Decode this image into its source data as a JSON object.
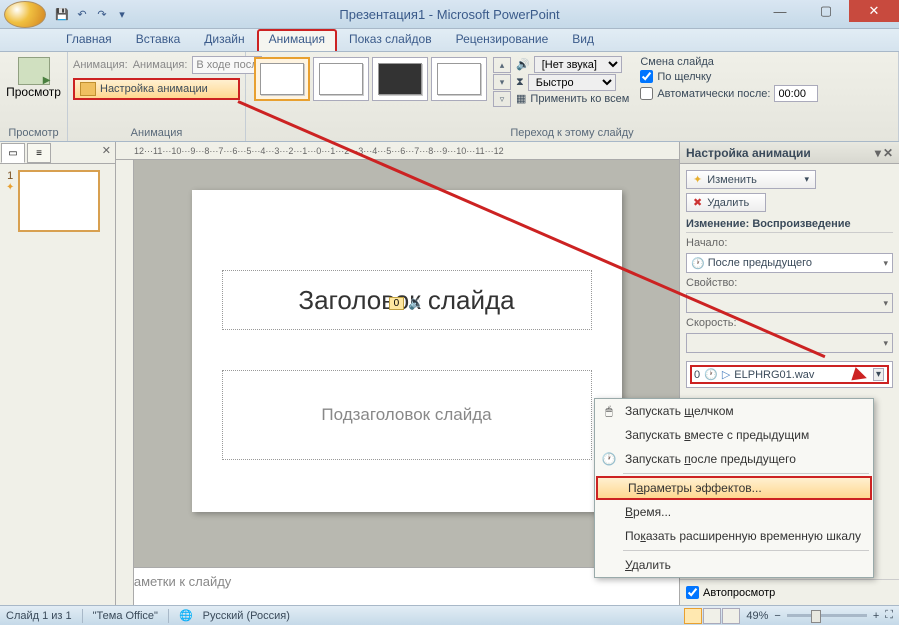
{
  "title": "Презентация1 - Microsoft PowerPoint",
  "tabs": [
    "Главная",
    "Вставка",
    "Дизайн",
    "Анимация",
    "Показ слайдов",
    "Рецензирование",
    "Вид"
  ],
  "active_tab": 3,
  "ribbon": {
    "preview": {
      "label": "Просмотр",
      "group": "Просмотр"
    },
    "anim": {
      "label": "Анимация:",
      "combo": "В ходе посл...",
      "custom": "Настройка анимации",
      "group": "Анимация"
    },
    "transition": {
      "group": "Переход к этому слайду",
      "sound_lbl": "[Нет звука]",
      "speed": "Быстро",
      "apply": "Применить ко всем"
    },
    "change": {
      "title": "Смена слайда",
      "click": "По щелчку",
      "auto": "Автоматически после:",
      "time": "00:00"
    }
  },
  "ruler": "12···11···10···9···8···7···6···5···4···3···2···1···0···1···2···3···4···5···6···7···8···9···10···11···12",
  "slide": {
    "title": "Заголовок слайда",
    "subtitle": "Подзаголовок слайда",
    "sound_num": "0"
  },
  "notes": "Заметки к слайду",
  "taskpane": {
    "title": "Настройка анимации",
    "change": "Изменить",
    "delete": "Удалить",
    "section": "Изменение: Воспроизведение",
    "start_lbl": "Начало:",
    "start_val": "После предыдущего",
    "prop_lbl": "Свойство:",
    "speed_lbl": "Скорость:",
    "item_num": "0",
    "item_name": "ELPHRG01.wav",
    "autopreview": "Автопросмотр"
  },
  "ctx": {
    "click": "Запускать щелчком",
    "with": "Запускать вместе с предыдущим",
    "after": "Запускать после предыдущего",
    "params": "Параметры эффектов...",
    "time": "Время...",
    "timeline": "Показать расширенную временную шкалу",
    "remove": "Удалить"
  },
  "status": {
    "slide": "Слайд 1 из 1",
    "theme": "\"Тема Office\"",
    "lang": "Русский (Россия)",
    "zoom": "49%"
  }
}
